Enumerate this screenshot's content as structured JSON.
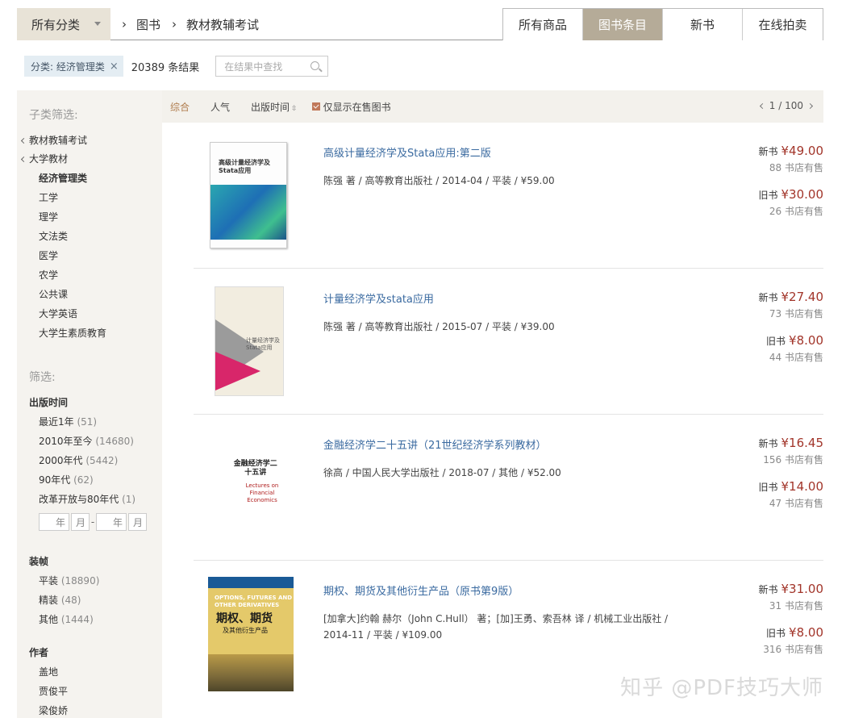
{
  "topbar": {
    "category_select": "所有分类",
    "breadcrumbs": [
      "图书",
      "教材教辅考试"
    ],
    "tabs": [
      {
        "label": "所有商品",
        "active": false
      },
      {
        "label": "图书条目",
        "active": true
      },
      {
        "label": "新书",
        "active": false
      },
      {
        "label": "在线拍卖",
        "active": false
      }
    ]
  },
  "filter": {
    "chip_label": "分类: 经济管理类",
    "chip_close": "×",
    "result_count": "20389 条结果",
    "search_placeholder": "在结果中查找"
  },
  "sidebar": {
    "subcat_heading": "子类筛选:",
    "parents": [
      "教材教辅考试",
      "大学教材"
    ],
    "subcats": [
      "经济管理类",
      "工学",
      "理学",
      "文法类",
      "医学",
      "农学",
      "公共课",
      "大学英语",
      "大学生素质教育"
    ],
    "filter_heading": "筛选:",
    "pub_time": {
      "title": "出版时间",
      "options": [
        {
          "label": "最近1年",
          "count": "(51)"
        },
        {
          "label": "2010年至今",
          "count": "(14680)"
        },
        {
          "label": "2000年代",
          "count": "(5442)"
        },
        {
          "label": "90年代",
          "count": "(62)"
        },
        {
          "label": "改革开放与80年代",
          "count": "(1)"
        }
      ],
      "year_unit": "年",
      "month_unit": "月",
      "dash": "-"
    },
    "binding": {
      "title": "装帧",
      "options": [
        {
          "label": "平装",
          "count": "(18890)"
        },
        {
          "label": "精装",
          "count": "(48)"
        },
        {
          "label": "其他",
          "count": "(1444)"
        }
      ]
    },
    "author": {
      "title": "作者",
      "options": [
        "盖地",
        "贾俊平",
        "梁俊娇"
      ]
    }
  },
  "sortbar": {
    "options": [
      "综合",
      "人气",
      "出版时间"
    ],
    "in_stock_label": "仅显示在售图书",
    "pager": "1 / 100"
  },
  "items": [
    {
      "title": "高级计量经济学及Stata应用:第二版",
      "meta": "陈强 著 / 高等教育出版社 / 2014-04 / 平装 / ¥59.00",
      "new_label": "新书",
      "new_price": "¥49.00",
      "new_stores": "88 书店有售",
      "used_label": "旧书",
      "used_price": "¥30.00",
      "used_stores": "26 书店有售",
      "cover_text": "高级计量经济学及Stata应用"
    },
    {
      "title": "计量经济学及stata应用",
      "meta": "陈强 著 / 高等教育出版社 / 2015-07 / 平装 / ¥39.00",
      "new_label": "新书",
      "new_price": "¥27.40",
      "new_stores": "73 书店有售",
      "used_label": "旧书",
      "used_price": "¥8.00",
      "used_stores": "44 书店有售",
      "cover_text": "计量经济学及Stata应用"
    },
    {
      "title": "金融经济学二十五讲（21世纪经济学系列教材）",
      "meta": "徐高 / 中国人民大学出版社 / 2018-07 / 其他 / ¥52.00",
      "new_label": "新书",
      "new_price": "¥16.45",
      "new_stores": "156 书店有售",
      "used_label": "旧书",
      "used_price": "¥14.00",
      "used_stores": "47 书店有售",
      "cover_text": "金融经济学二十五讲",
      "cover_sub": "Lectures on Financial Economics"
    },
    {
      "title": "期权、期货及其他衍生产品（原书第9版）",
      "meta": "[加拿大]约翰 赫尔（John C.Hull） 著；[加]王勇、索吾林 译 / 机械工业出版社 / 2014-11 / 平装 / ¥109.00",
      "new_label": "新书",
      "new_price": "¥31.00",
      "new_stores": "31 书店有售",
      "used_label": "旧书",
      "used_price": "¥8.00",
      "used_stores": "316 书店有售",
      "cover_text": "期权、期货",
      "cover_en": "OPTIONS, FUTURES AND OTHER DERIVATIVES",
      "cover_sub": "及其他衍生产品"
    }
  ],
  "watermark": "知乎 @PDF技巧大师",
  "colors": {
    "accent": "#b07d4e",
    "price": "#a2352a",
    "link": "#3a6aa0",
    "tab_active": "#b5ab98"
  }
}
